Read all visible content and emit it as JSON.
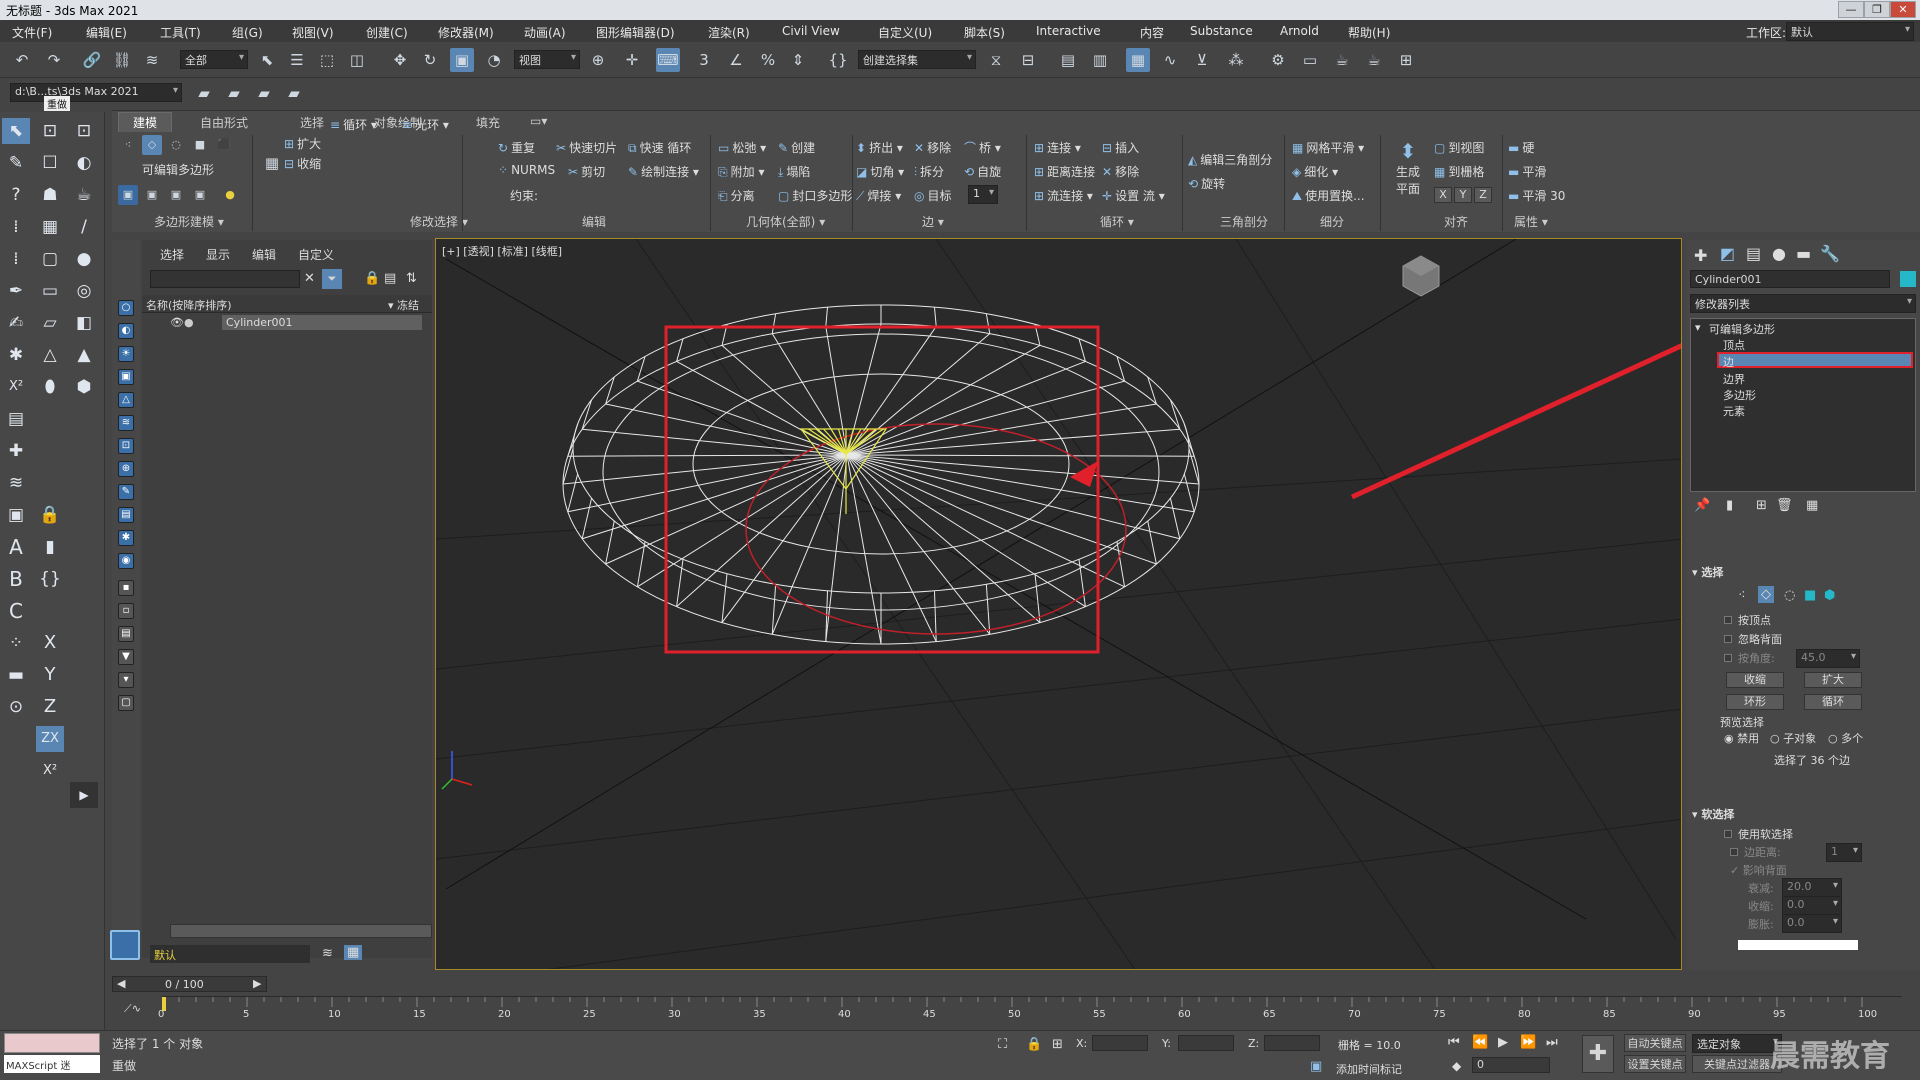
{
  "window": {
    "title": "无标题 - 3ds Max 2021",
    "workspace_label": "工作区:",
    "workspace_value": "默认"
  },
  "menu": [
    "文件(F)",
    "编辑(E)",
    "工具(T)",
    "组(G)",
    "视图(V)",
    "创建(C)",
    "修改器(M)",
    "动画(A)",
    "图形编辑器(D)",
    "渲染(R)",
    "Civil View",
    "自定义(U)",
    "脚本(S)",
    "Interactive",
    "内容",
    "Substance",
    "Arnold",
    "帮助(H)"
  ],
  "toolbar": {
    "filter_select": "全部",
    "view_select": "视图",
    "named_sel": "创建选择集",
    "path": "d:\\B...ts\\3ds Max 2021",
    "tooltip": "重做"
  },
  "ribbon": {
    "tabs": [
      "建模",
      "自由形式",
      "选择",
      "对象绘制",
      "填充"
    ],
    "groups": [
      "多边形建模",
      "修改选择",
      "编辑",
      "几何体(全部)",
      "边",
      "循环",
      "三角剖分",
      "细分",
      "对齐",
      "属性"
    ],
    "polymodel": {
      "label": "可编辑多边形"
    },
    "modsel": {
      "grow": "扩大",
      "shrink": "收缩",
      "loop": "循环",
      "ring": "光环"
    },
    "edit": {
      "repeat": "重复",
      "quickslice": "快速切片",
      "quickloop": "快速 循环",
      "nurms": "NURMS",
      "cut": "剪切",
      "paintconnect": "绘制连接",
      "constraint": "约束:"
    },
    "geom": {
      "relax": "松弛",
      "create": "创建",
      "attach": "附加",
      "collapse": "塌陷",
      "detach": "分离",
      "cap": "封口多边形"
    },
    "edge": {
      "extrude": "挤出",
      "remove": "移除",
      "bridge": "桥",
      "chamfer": "切角",
      "split": "拆分",
      "weld": "自旋",
      "weld2": "焊接",
      "target": "目标",
      "num": "1"
    },
    "loop": {
      "connect": "连接",
      "insert": "插入",
      "distconnect": "距离连接",
      "remove": "移除",
      "flowconnect": "流连接",
      "setflow": "设置 流"
    },
    "tri": {
      "edittri": "编辑三角剖分",
      "turn": "旋转"
    },
    "subdiv": {
      "meshsmooth": "网格平滑",
      "tess": "细化",
      "usedisp": "使用置换..."
    },
    "align": {
      "gen": "生成",
      "plane": "平面",
      "toview": "到视图",
      "togrid": "到栅格",
      "x": "X",
      "y": "Y",
      "z": "Z"
    },
    "props": {
      "hard": "硬",
      "smooth": "平滑",
      "smooth30": "平滑 30"
    }
  },
  "scene": {
    "tabs": [
      "选择",
      "显示",
      "编辑",
      "自定义"
    ],
    "col_name": "名称(按降序排序)",
    "col_freeze": "冻结",
    "object": "Cylinder001",
    "layer": "默认"
  },
  "viewport": {
    "label": "[+] [透视] [标准] [线框]"
  },
  "cmd": {
    "object_name": "Cylinder001",
    "modlist": "修改器列表",
    "stack": [
      "可编辑多边形",
      "顶点",
      "边",
      "边界",
      "多边形",
      "元素"
    ],
    "sel_title": "选择",
    "byvertex": "按顶点",
    "ignoreback": "忽略背面",
    "byangle": "按角度:",
    "angle_val": "45.0",
    "shrink": "收缩",
    "grow": "扩大",
    "ring": "环形",
    "loop": "循环",
    "preview": "预览选择",
    "disable": "禁用",
    "subobj": "子对象",
    "multi": "多个",
    "selected": "选择了 36 个边",
    "soft_title": "软选择",
    "usesoft": "使用软选择",
    "edgedist": "边距离:",
    "edgedist_val": "1",
    "affectback": "影响背面",
    "falloff": "衰减:",
    "falloff_val": "20.0",
    "pinch": "收缩:",
    "pinch_val": "0.0",
    "bubble": "膨胀:",
    "bubble_val": "0.0"
  },
  "time": {
    "frame": "0 / 100",
    "ticks": [
      "0",
      "5",
      "10",
      "15",
      "20",
      "25",
      "30",
      "35",
      "40",
      "45",
      "50",
      "55",
      "60",
      "65",
      "70",
      "75",
      "80",
      "85",
      "90",
      "95",
      "100"
    ]
  },
  "status": {
    "selected": "选择了 1 个 对象",
    "action": "重做",
    "script": "MAXScript 迷",
    "x": "X:",
    "y": "Y:",
    "z": "Z:",
    "grid": "栅格 = 10.0",
    "addtime": "添加时间标记",
    "autokey": "自动关键点",
    "setkey": "设置关键点",
    "selobj": "选定对象",
    "keyfilter": "关键点过滤器",
    "frame0": "0",
    "watermark": "晨需教育"
  },
  "colors": {
    "accent": "#5a86b4",
    "selection_red": "#e0202a",
    "viewport_border": "#a88a2b",
    "wire": "#e8e8e8",
    "yellow": "#e8e84a"
  }
}
